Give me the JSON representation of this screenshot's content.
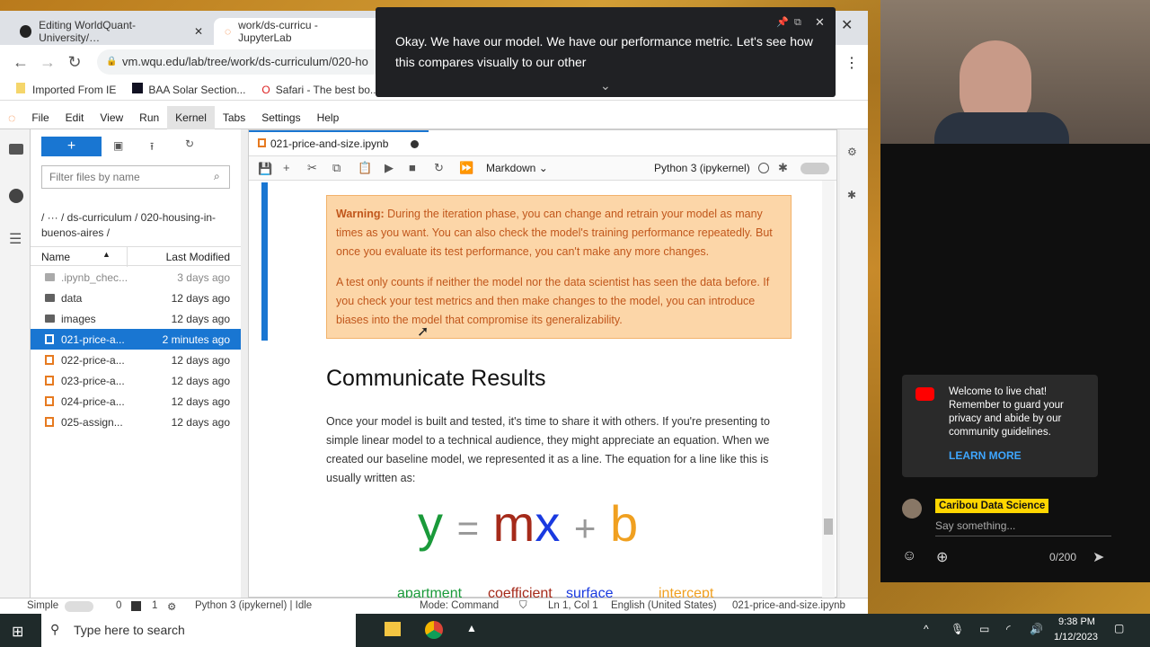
{
  "browser": {
    "tabs": [
      {
        "label": "Editing WorldQuant-University/…"
      },
      {
        "label": "work/ds-curricu - JupyterLab"
      }
    ],
    "url": "vm.wqu.edu/lab/tree/work/ds-curriculum/020-ho",
    "bookmarks": [
      "Imported From IE",
      "BAA Solar Section...",
      "Safari - The best bo..."
    ]
  },
  "caption": {
    "text": "Okay. We have our model. We have our performance metric. Let's see how this compares visually to our other"
  },
  "jupyter": {
    "menu": [
      "File",
      "Edit",
      "View",
      "Run",
      "Kernel",
      "Tabs",
      "Settings",
      "Help"
    ],
    "filter_placeholder": "Filter files by name",
    "breadcrumb": "/  ···  / ds-curriculum / 020-housing-in-buenos-aires /",
    "columns": {
      "name": "Name",
      "modified": "Last Modified"
    },
    "files": [
      {
        "name": ".ipynb_chec...",
        "modified": "3 days ago",
        "type": "folder"
      },
      {
        "name": "data",
        "modified": "12 days ago",
        "type": "folder"
      },
      {
        "name": "images",
        "modified": "12 days ago",
        "type": "folder"
      },
      {
        "name": "021-price-a...",
        "modified": "2 minutes ago",
        "type": "notebook"
      },
      {
        "name": "022-price-a...",
        "modified": "12 days ago",
        "type": "notebook"
      },
      {
        "name": "023-price-a...",
        "modified": "12 days ago",
        "type": "notebook"
      },
      {
        "name": "024-price-a...",
        "modified": "12 days ago",
        "type": "notebook"
      },
      {
        "name": "025-assign...",
        "modified": "12 days ago",
        "type": "notebook"
      }
    ],
    "notebook_tab": "021-price-and-size.ipynb",
    "cell_type": "Markdown",
    "kernel": "Python 3 (ipykernel)",
    "warning": {
      "label": "Warning:",
      "p1": " During the iteration phase, you can change and retrain your model as many times as you want. You can also check the model's training performance repeatedly. But once you evaluate its test performance, you can't make any more changes.",
      "p2": "A test only counts if neither the model nor the data scientist has seen the data before. If you check your test metrics and then make changes to the model, you can introduce biases into the model that compromise its generalizability."
    },
    "heading": "Communicate Results",
    "body": "Once your model is built and tested, it's time to share it with others. If you're presenting to simple linear model to a technical audience, they might appreciate an equation. When we created our baseline model, we represented it as a line. The equation for a line like this is usually written as:",
    "equation": {
      "y": "y",
      "eq": "=",
      "m": "m",
      "x": "x",
      "plus": "+",
      "b": "b",
      "labels": [
        "apartment",
        "coefficient",
        "surface",
        "intercept"
      ]
    },
    "status": {
      "mode_label": "Simple",
      "zero": "0",
      "one": "1",
      "kernel_status": "Python 3 (ipykernel) | Idle",
      "mode": "Mode: Command",
      "pos": "Ln 1, Col 1",
      "lang": "English (United States)",
      "file": "021-price-and-size.ipynb"
    }
  },
  "chat": {
    "welcome": "Welcome to live chat! Remember to guard your privacy and abide by our community guidelines.",
    "learn_more": "LEARN MORE",
    "user": "Caribou Data Science",
    "placeholder": "Say something...",
    "counter": "0/200"
  },
  "taskbar": {
    "search": "Type here to search",
    "time": "9:38 PM",
    "date": "1/12/2023"
  }
}
